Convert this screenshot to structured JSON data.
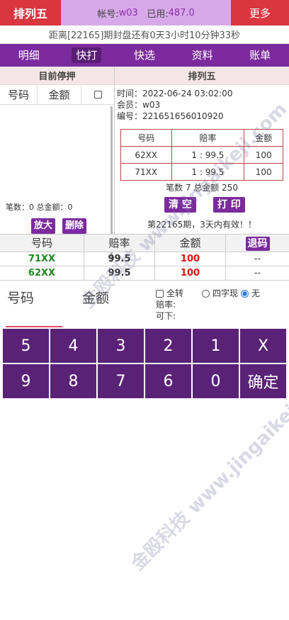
{
  "header": {
    "title": "排列五",
    "account_label": "帐号:",
    "account": "w03",
    "used_label": "已用:",
    "used": "487.0",
    "more": "更多"
  },
  "countdown": "距离[22165]期封盘还有0天3小时10分钟33秒",
  "nav": {
    "tabs": [
      "明细",
      "快打",
      "快选",
      "资料",
      "账单"
    ],
    "active": 1
  },
  "left_panel": {
    "title": "目前停押",
    "col_number": "号码",
    "col_amount": "金额",
    "footer": "笔数：0   总金额：0",
    "enlarge": "放大",
    "delete": "删除"
  },
  "right_panel": {
    "title": "排列五",
    "time": "时间：2022-06-24 03:02:00",
    "member": "会员：w03",
    "serial": "编号：221651656010920",
    "table_headers": [
      "号码",
      "赔率",
      "金额"
    ],
    "rows": [
      {
        "number": "62XX",
        "odds": "1 : 99.5",
        "amount": "100"
      },
      {
        "number": "71XX",
        "odds": "1 : 99.5",
        "amount": "100"
      }
    ],
    "summary": "笔数 7 总金额 250",
    "clear": "清 空",
    "print": "打 印",
    "validity": "第22165期，3天内有效！！"
  },
  "bet_list": {
    "headers": [
      "号码",
      "赔率",
      "金额"
    ],
    "refund": "退码",
    "rows": [
      {
        "number": "71XX",
        "odds": "99.5",
        "amount": "100",
        "action": "--"
      },
      {
        "number": "62XX",
        "odds": "99.5",
        "amount": "100",
        "action": "--"
      }
    ]
  },
  "input_area": {
    "number_label": "号码",
    "amount_label": "金额",
    "full_turn": "全转",
    "four_digit": "四字现",
    "none": "无",
    "odds_label": "赔率:",
    "max_label": "可下:"
  },
  "keypad": [
    "5",
    "4",
    "3",
    "2",
    "1",
    "X",
    "9",
    "8",
    "7",
    "6",
    "0",
    "确定"
  ],
  "watermark": "金殴科技 www.jingaikeji.com",
  "colors": {
    "brand_red": "#d93640",
    "purple": "#7b2b9d",
    "key": "#5a2277",
    "number_green": "#1e8a1e",
    "amount_red": "#d11111"
  }
}
